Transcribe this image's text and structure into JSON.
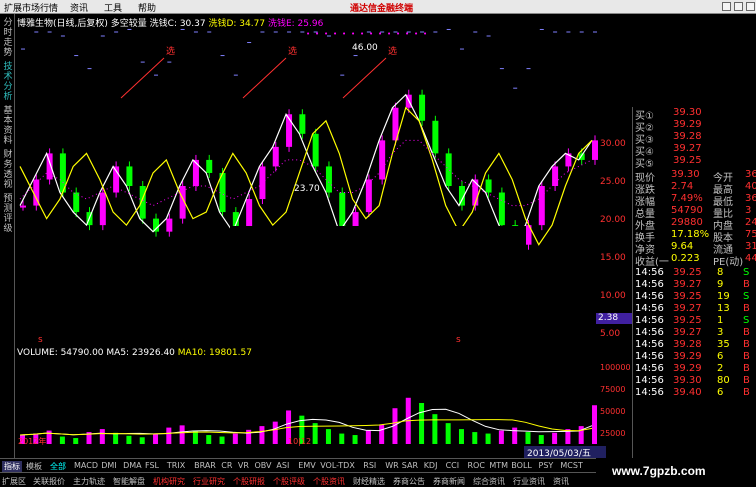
{
  "menu": {
    "items": [
      "扩展市场行情",
      "资讯",
      "工具",
      "帮助"
    ],
    "brand": "通达信金融终端"
  },
  "leftnav": [
    "分时走势",
    "技术分析",
    "基本资料",
    "财务透视",
    "预测评级"
  ],
  "chart": {
    "stock": "博雅生物(日线,后复权)",
    "indicator": "多空较量",
    "v1": "洗钱C: 30.37",
    "v2": "洗钱D: 34.77",
    "v3": "洗钱E: 25.96",
    "annotations": [
      "选",
      "选",
      "选"
    ],
    "high_label": "46.00",
    "low_label": "23.70",
    "marker_s": [
      "s",
      "s"
    ],
    "yticks": [
      "30.00",
      "25.00",
      "20.00",
      "15.00",
      "10.00",
      "5.00"
    ],
    "current_price": "2.38",
    "x_start": "2012年",
    "x_month": "10|12"
  },
  "chart_data": {
    "type": "line",
    "series": [
      {
        "name": "洗钱C",
        "color": "#ffffff",
        "values": [
          20,
          24,
          28,
          22,
          19,
          17,
          22,
          26,
          23,
          18,
          16,
          18,
          23,
          27,
          25,
          19,
          16,
          21,
          26,
          29,
          34,
          31,
          26,
          22,
          16,
          19,
          24,
          30,
          35,
          37,
          33,
          28,
          23,
          20,
          24,
          22,
          17,
          14,
          17,
          23,
          26,
          28,
          27,
          30
        ]
      },
      {
        "name": "洗钱D",
        "color": "#ffff00",
        "values": [
          26,
          22,
          18,
          21,
          26,
          28,
          24,
          19,
          17,
          20,
          25,
          27,
          22,
          18,
          19,
          24,
          28,
          25,
          20,
          17,
          19,
          25,
          31,
          33,
          28,
          21,
          18,
          20,
          28,
          35,
          33,
          27,
          20,
          16,
          19,
          25,
          28,
          24,
          18,
          14,
          17,
          23,
          28,
          30
        ]
      },
      {
        "name": "洗钱E",
        "color": "#ff00ff",
        "values": [
          21,
          23,
          25,
          24,
          22,
          21,
          22,
          23,
          22,
          21,
          20,
          21,
          22,
          23,
          23,
          22,
          21,
          22,
          23,
          25,
          27,
          27,
          26,
          24,
          22,
          22,
          23,
          25,
          28,
          30,
          30,
          28,
          26,
          24,
          23,
          22,
          21,
          20,
          20,
          21,
          23,
          25,
          26,
          27
        ]
      }
    ],
    "ylim": [
      0,
      46
    ]
  },
  "volume": {
    "label": "VOLUME: 54790.00",
    "ma5": "MA5: 23926.40",
    "ma10": "MA10: 19801.57",
    "yticks": [
      "100000",
      "75000",
      "50000",
      "25000"
    ],
    "values": [
      12,
      14,
      18,
      10,
      8,
      16,
      20,
      15,
      11,
      9,
      13,
      22,
      25,
      18,
      12,
      10,
      14,
      19,
      24,
      30,
      45,
      38,
      28,
      20,
      14,
      12,
      18,
      26,
      48,
      62,
      55,
      40,
      28,
      20,
      16,
      14,
      18,
      22,
      16,
      12,
      15,
      20,
      24,
      52
    ],
    "ylim": [
      0,
      110
    ]
  },
  "quote": {
    "asks": [
      {
        "label": "买①",
        "price": "39.30",
        "vol": ""
      },
      {
        "label": "买②",
        "price": "39.29",
        "vol": ""
      },
      {
        "label": "买③",
        "price": "39.28",
        "vol": ""
      },
      {
        "label": "买④",
        "price": "39.27",
        "vol": ""
      },
      {
        "label": "买⑤",
        "price": "39.25",
        "vol": ""
      }
    ],
    "stats": [
      {
        "l1": "现价",
        "v1": "39.30",
        "l2": "今开",
        "v2": "36"
      },
      {
        "l1": "涨跌",
        "v1": "2.74",
        "l2": "最高",
        "v2": "40"
      },
      {
        "l1": "涨幅",
        "v1": "7.49%",
        "l2": "最低",
        "v2": "36"
      },
      {
        "l1": "总量",
        "v1": "54790",
        "l2": "量比",
        "v2": "3"
      },
      {
        "l1": "外盘",
        "v1": "29880",
        "l2": "内盘",
        "v2": "24"
      },
      {
        "l1": "换手",
        "v1": "17.18%",
        "l2": "股本",
        "v2": "758"
      },
      {
        "l1": "净资",
        "v1": "9.64",
        "l2": "流通",
        "v2": "318"
      },
      {
        "l1": "收益(一",
        "v1": "0.223",
        "l2": "PE(动)",
        "v2": "44"
      }
    ],
    "ticks": [
      {
        "t": "14:56",
        "p": "39.25",
        "v": "8",
        "d": "S"
      },
      {
        "t": "14:56",
        "p": "39.27",
        "v": "9",
        "d": "B"
      },
      {
        "t": "14:56",
        "p": "39.25",
        "v": "19",
        "d": "S"
      },
      {
        "t": "14:56",
        "p": "39.27",
        "v": "13",
        "d": "B"
      },
      {
        "t": "14:56",
        "p": "39.25",
        "v": "1",
        "d": "S"
      },
      {
        "t": "14:56",
        "p": "39.27",
        "v": "3",
        "d": "B"
      },
      {
        "t": "14:56",
        "p": "39.28",
        "v": "35",
        "d": "B"
      },
      {
        "t": "14:56",
        "p": "39.29",
        "v": "6",
        "d": "B"
      },
      {
        "t": "14:56",
        "p": "39.29",
        "v": "2",
        "d": "B"
      },
      {
        "t": "14:56",
        "p": "39.30",
        "v": "80",
        "d": "B"
      },
      {
        "t": "14:56",
        "p": "39.40",
        "v": "6",
        "d": "B"
      }
    ]
  },
  "date_badge": "2013/05/03/五",
  "indicator_tabs": [
    "指标",
    "模板",
    "全部",
    "MACD",
    "DMI",
    "DMA",
    "FSL",
    "TRIX",
    "BRAR",
    "CR",
    "VR",
    "OBV",
    "ASI",
    "EMV",
    "VOL-TDX",
    "RSI",
    "WR",
    "SAR",
    "KDJ",
    "CCI",
    "ROC",
    "MTM",
    "BOLL",
    "PSY",
    "MCST"
  ],
  "bottom_tabs": [
    "扩展区",
    "关联报价",
    "主力轨迹",
    "智能解盘",
    "机构研究",
    "行业研究",
    "个股研报",
    "个股评级",
    "个股资讯",
    "财经精选",
    "券商公告",
    "券商新闻",
    "综合资讯",
    "行业资讯",
    "资讯"
  ],
  "watermark": "www.7gpzb.com"
}
